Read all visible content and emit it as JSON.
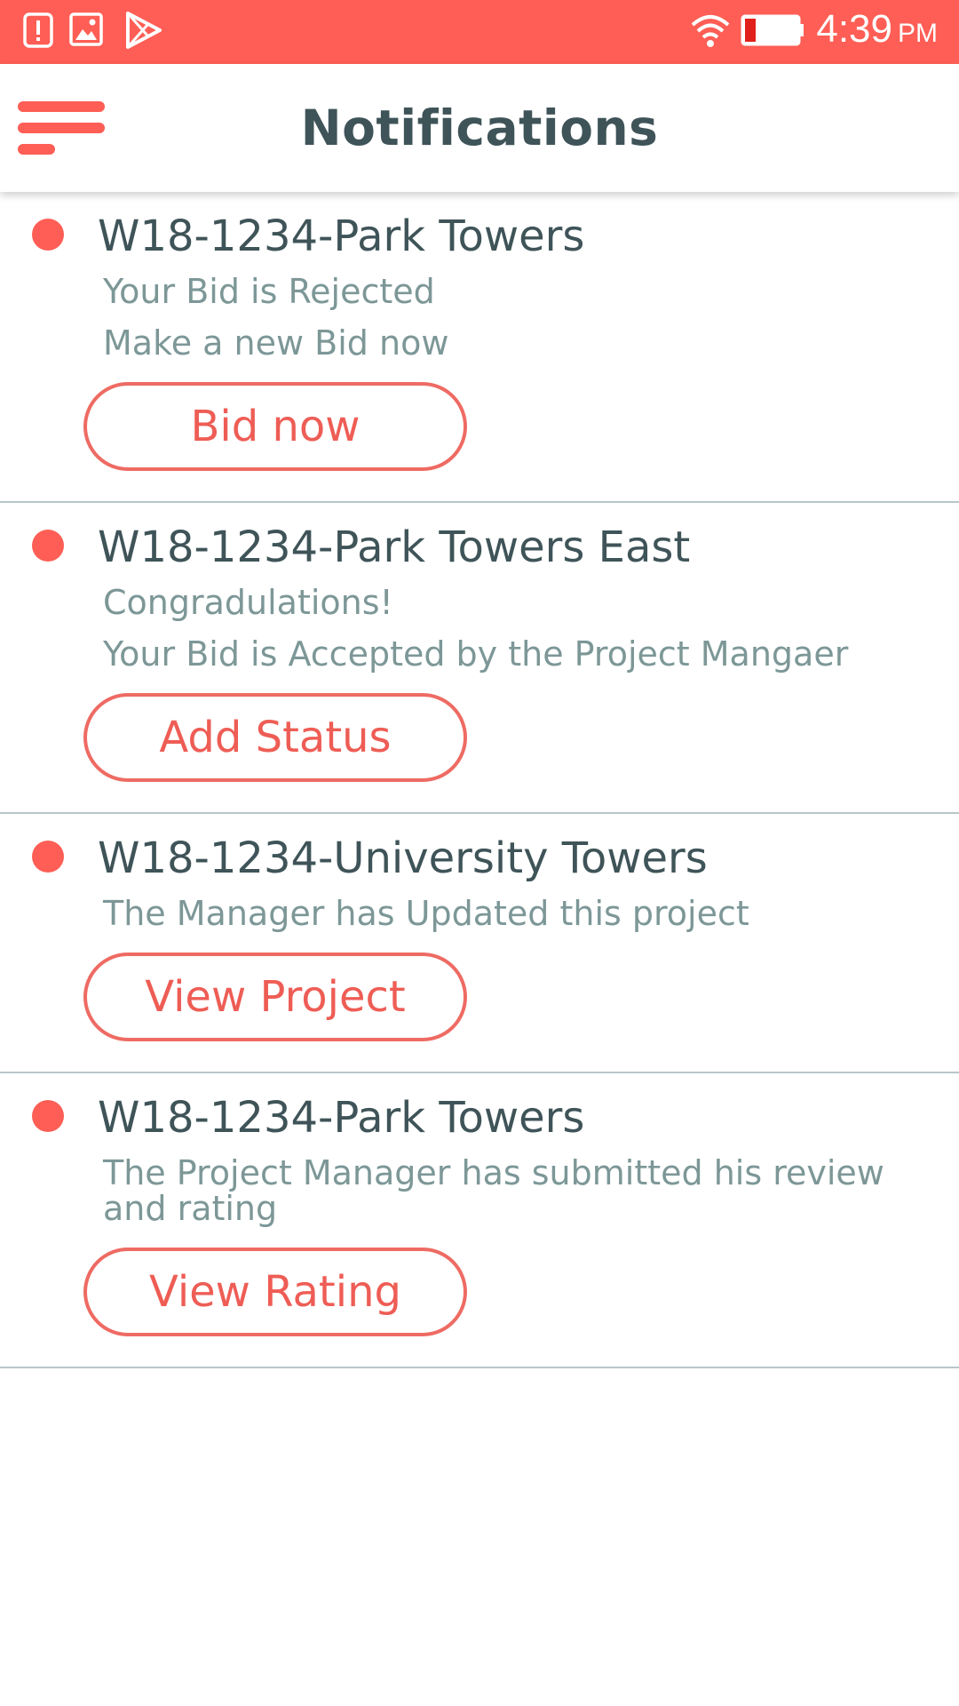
{
  "status_bar": {
    "time": "4:39",
    "ampm": "PM",
    "icons": [
      "alert-notification-icon",
      "image-notification-icon",
      "play-store-icon",
      "wifi-icon",
      "battery-low-icon"
    ]
  },
  "header": {
    "title": "Notifications",
    "menu_icon": "hamburger-menu-icon"
  },
  "notifications": [
    {
      "title": "W18-1234-Park Towers",
      "lines": [
        "Your Bid is Rejected",
        "Make a new Bid now"
      ],
      "button": "Bid now"
    },
    {
      "title": "W18-1234-Park Towers East",
      "lines": [
        "Congradulations!",
        "Your Bid is Accepted by the Project Mangaer"
      ],
      "button": "Add Status"
    },
    {
      "title": "W18-1234-University Towers",
      "lines": [
        "The Manager has Updated this project"
      ],
      "button": "View Project"
    },
    {
      "title": "W18-1234-Park Towers",
      "lines": [
        "The Project Manager has submitted his review and rating"
      ],
      "button": "View Rating"
    }
  ],
  "colors": {
    "accent": "#fe5e55",
    "title_text": "#3f5458",
    "body_text": "#7d9797",
    "divider": "#b7c7c8"
  }
}
